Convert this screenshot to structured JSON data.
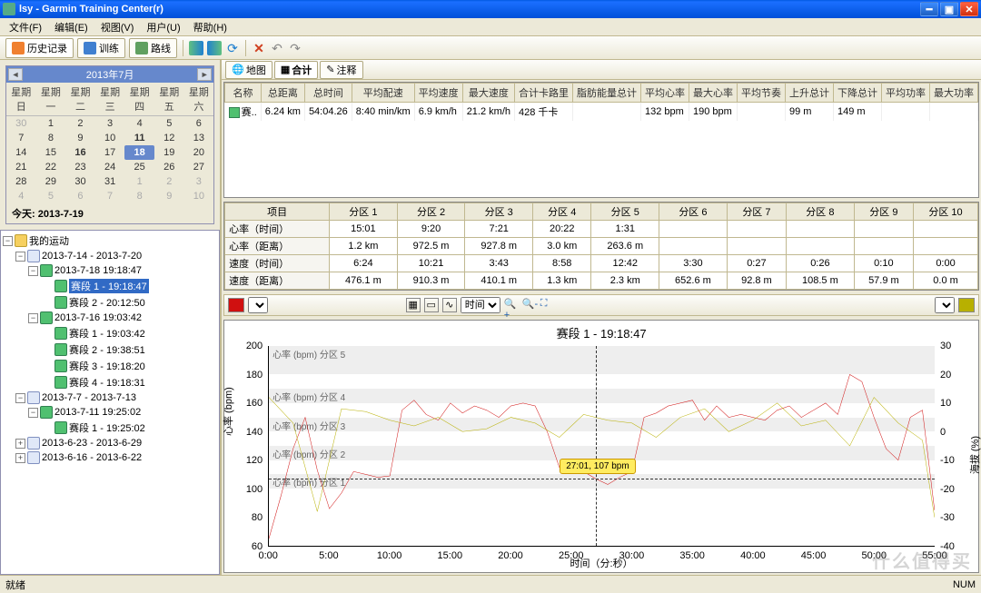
{
  "window": {
    "title": "lsy - Garmin Training Center(r)"
  },
  "menu": [
    "文件(F)",
    "编辑(E)",
    "视图(V)",
    "用户(U)",
    "帮助(H)"
  ],
  "toolbar": {
    "tabs": [
      {
        "icon": "history-icon",
        "label": "历史记录",
        "active": true
      },
      {
        "icon": "training-icon",
        "label": "训练"
      },
      {
        "icon": "route-icon",
        "label": "路线"
      }
    ]
  },
  "calendar": {
    "title": "2013年7月",
    "weekdays": [
      "星期日",
      "星期一",
      "星期二",
      "星期三",
      "星期四",
      "星期五",
      "星期六"
    ],
    "rows": [
      [
        {
          "d": "30",
          "g": 1
        },
        {
          "d": "1"
        },
        {
          "d": "2"
        },
        {
          "d": "3"
        },
        {
          "d": "4"
        },
        {
          "d": "5"
        },
        {
          "d": "6"
        }
      ],
      [
        {
          "d": "7"
        },
        {
          "d": "8"
        },
        {
          "d": "9"
        },
        {
          "d": "10"
        },
        {
          "d": "11",
          "b": 1
        },
        {
          "d": "12"
        },
        {
          "d": "13"
        }
      ],
      [
        {
          "d": "14"
        },
        {
          "d": "15"
        },
        {
          "d": "16",
          "b": 1
        },
        {
          "d": "17"
        },
        {
          "d": "18",
          "s": 1
        },
        {
          "d": "19"
        },
        {
          "d": "20"
        }
      ],
      [
        {
          "d": "21"
        },
        {
          "d": "22"
        },
        {
          "d": "23"
        },
        {
          "d": "24"
        },
        {
          "d": "25"
        },
        {
          "d": "26"
        },
        {
          "d": "27"
        }
      ],
      [
        {
          "d": "28"
        },
        {
          "d": "29"
        },
        {
          "d": "30"
        },
        {
          "d": "31"
        },
        {
          "d": "1",
          "g": 1
        },
        {
          "d": "2",
          "g": 1
        },
        {
          "d": "3",
          "g": 1
        }
      ],
      [
        {
          "d": "4",
          "g": 1
        },
        {
          "d": "5",
          "g": 1
        },
        {
          "d": "6",
          "g": 1
        },
        {
          "d": "7",
          "g": 1
        },
        {
          "d": "8",
          "g": 1
        },
        {
          "d": "9",
          "g": 1
        },
        {
          "d": "10",
          "g": 1
        }
      ]
    ],
    "today": "今天: 2013-7-19"
  },
  "tree": {
    "root": "我的运动",
    "nodes": [
      {
        "lvl": 1,
        "exp": "-",
        "ic": "cal",
        "txt": "2013-7-14 - 2013-7-20"
      },
      {
        "lvl": 2,
        "exp": "-",
        "ic": "run",
        "txt": "2013-7-18 19:18:47"
      },
      {
        "lvl": 3,
        "ic": "seg",
        "txt": "赛段 1 - 19:18:47",
        "sel": 1
      },
      {
        "lvl": 3,
        "ic": "seg",
        "txt": "赛段 2 - 20:12:50"
      },
      {
        "lvl": 2,
        "exp": "-",
        "ic": "run",
        "txt": "2013-7-16 19:03:42"
      },
      {
        "lvl": 3,
        "ic": "seg",
        "txt": "赛段 1 - 19:03:42"
      },
      {
        "lvl": 3,
        "ic": "seg",
        "txt": "赛段 2 - 19:38:51"
      },
      {
        "lvl": 3,
        "ic": "seg",
        "txt": "赛段 3 - 19:18:20"
      },
      {
        "lvl": 3,
        "ic": "seg",
        "txt": "赛段 4 - 19:18:31"
      },
      {
        "lvl": 1,
        "exp": "-",
        "ic": "cal",
        "txt": "2013-7-7 - 2013-7-13"
      },
      {
        "lvl": 2,
        "exp": "-",
        "ic": "run",
        "txt": "2013-7-11 19:25:02"
      },
      {
        "lvl": 3,
        "ic": "seg",
        "txt": "赛段 1 - 19:25:02"
      },
      {
        "lvl": 1,
        "exp": "+",
        "ic": "cal",
        "txt": "2013-6-23 - 2013-6-29"
      },
      {
        "lvl": 1,
        "exp": "+",
        "ic": "cal",
        "txt": "2013-6-16 - 2013-6-22"
      }
    ]
  },
  "right_tabs": [
    {
      "ic": "map",
      "label": "地图"
    },
    {
      "ic": "grid",
      "label": "合计",
      "active": 1
    },
    {
      "ic": "note",
      "label": "注释"
    }
  ],
  "summary": {
    "cols": [
      "名称",
      "总距离",
      "总时间",
      "平均配速",
      "平均速度",
      "最大速度",
      "合计卡路里",
      "脂肪能量总计",
      "平均心率",
      "最大心率",
      "平均节奏",
      "上升总计",
      "下降总计",
      "平均功率",
      "最大功率"
    ],
    "row": [
      "赛..",
      "6.24 km",
      "54:04.26",
      "8:40 min/km",
      "6.9 km/h",
      "21.2 km/h",
      "428 千卡",
      "",
      "132 bpm",
      "190 bpm",
      "",
      "99 m",
      "149 m",
      "",
      ""
    ]
  },
  "zones": {
    "head": [
      "项目",
      "分区 1",
      "分区 2",
      "分区 3",
      "分区 4",
      "分区 5",
      "分区 6",
      "分区 7",
      "分区 8",
      "分区 9",
      "分区 10"
    ],
    "rows": [
      [
        "心率（时间）",
        "15:01",
        "9:20",
        "7:21",
        "20:22",
        "1:31",
        "",
        "",
        "",
        "",
        ""
      ],
      [
        "心率（距离）",
        "1.2 km",
        "972.5 m",
        "927.8 m",
        "3.0 km",
        "263.6 m",
        "",
        "",
        "",
        "",
        ""
      ],
      [
        "速度（时间）",
        "6:24",
        "10:21",
        "3:43",
        "8:58",
        "12:42",
        "3:30",
        "0:27",
        "0:26",
        "0:10",
        "0:00"
      ],
      [
        "速度（距离）",
        "476.1 m",
        "910.3 m",
        "410.1 m",
        "1.3 km",
        "2.3 km",
        "652.6 m",
        "92.8 m",
        "108.5 m",
        "57.9 m",
        "0.0 m"
      ]
    ]
  },
  "chart_toolbar": {
    "left_color": "■",
    "x_select": "时间",
    "right_color": "■"
  },
  "chart_data": {
    "type": "line",
    "title": "赛段 1 - 19:18:47",
    "xlabel": "时间（分:秒）",
    "ylabel": "心率 (bpm)",
    "y2label": "海拔 (%)",
    "x_ticks": [
      "0:00",
      "5:00",
      "10:00",
      "15:00",
      "20:00",
      "25:00",
      "30:00",
      "35:00",
      "40:00",
      "45:00",
      "50:00",
      "55:00"
    ],
    "y_ticks": [
      60,
      80,
      100,
      120,
      140,
      160,
      180,
      200
    ],
    "y2_ticks": [
      -40,
      -30,
      -20,
      -10,
      0,
      10,
      20,
      30
    ],
    "ylim": [
      60,
      200
    ],
    "y2lim": [
      -40,
      30
    ],
    "zone_bands": [
      {
        "label": "心率 (bpm) 分区 5",
        "lo": 180,
        "hi": 200
      },
      {
        "label": "心率 (bpm) 分区 4",
        "lo": 160,
        "hi": 170
      },
      {
        "label": "心率 (bpm) 分区 3",
        "lo": 140,
        "hi": 150
      },
      {
        "label": "心率 (bpm) 分区 2",
        "lo": 120,
        "hi": 130
      },
      {
        "label": "心率 (bpm) 分区 1",
        "lo": 100,
        "hi": 110
      }
    ],
    "cursor": {
      "x": 27.02,
      "label": "27:01, 107 bpm",
      "y": 107
    },
    "series": [
      {
        "name": "心率",
        "axis": "y",
        "color": "#d01010",
        "x": [
          0,
          1,
          2,
          3,
          4,
          5,
          6,
          7,
          8,
          9,
          10,
          11,
          12,
          13,
          14,
          15,
          16,
          17,
          18,
          19,
          20,
          21,
          22,
          23,
          24,
          25,
          26,
          27,
          28,
          29,
          30,
          31,
          32,
          33,
          34,
          35,
          36,
          37,
          38,
          39,
          40,
          41,
          42,
          43,
          44,
          45,
          46,
          47,
          48,
          49,
          50,
          51,
          52,
          53,
          54,
          55
        ],
        "y": [
          65,
          95,
          128,
          150,
          113,
          86,
          97,
          112,
          110,
          108,
          109,
          155,
          162,
          152,
          148,
          160,
          153,
          158,
          155,
          150,
          158,
          160,
          158,
          140,
          115,
          115,
          112,
          107,
          103,
          108,
          112,
          150,
          153,
          158,
          160,
          162,
          148,
          158,
          150,
          152,
          150,
          148,
          155,
          158,
          150,
          155,
          160,
          152,
          180,
          175,
          150,
          128,
          120,
          150,
          155,
          85
        ]
      },
      {
        "name": "海拔",
        "axis": "y2",
        "color": "#b8b000",
        "x": [
          0,
          2,
          4,
          6,
          8,
          10,
          12,
          14,
          16,
          18,
          20,
          22,
          24,
          26,
          28,
          30,
          32,
          34,
          36,
          38,
          40,
          42,
          44,
          46,
          48,
          50,
          52,
          54,
          55
        ],
        "y": [
          12,
          3,
          -28,
          8,
          7,
          4,
          2,
          5,
          0,
          1,
          5,
          3,
          -2,
          6,
          4,
          3,
          -2,
          5,
          8,
          0,
          4,
          10,
          2,
          4,
          -5,
          12,
          3,
          -3,
          -30
        ]
      }
    ]
  },
  "status": {
    "left": "就绪",
    "right": "NUM"
  },
  "watermark": "什么值得买"
}
